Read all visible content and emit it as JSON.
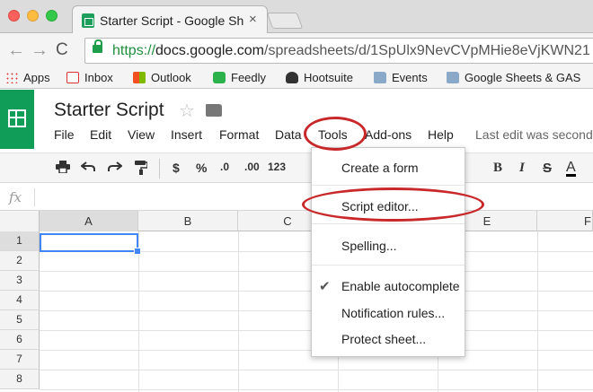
{
  "browser": {
    "tab_title": "Starter Script - Google Sheets",
    "tab_close": "×",
    "nav": {
      "back": "←",
      "forward": "→",
      "reload": "C"
    },
    "url_scheme": "https://",
    "url_host": "docs.google.com",
    "url_path": "/spreadsheets/d/1SpUlx9NevCVpMHie8eVjKWN21",
    "bookmarks": [
      {
        "label": "Apps",
        "icon": "apps-grid-icon"
      },
      {
        "label": "Inbox",
        "icon": "gmail-icon"
      },
      {
        "label": "Outlook",
        "icon": "outlook-icon"
      },
      {
        "label": "Feedly",
        "icon": "feedly-icon"
      },
      {
        "label": "Hootsuite",
        "icon": "hootsuite-icon"
      },
      {
        "label": "Events",
        "icon": "folder-icon"
      },
      {
        "label": "Google Sheets & GAS",
        "icon": "folder-icon"
      }
    ]
  },
  "doc": {
    "title": "Starter Script",
    "star": "☆",
    "last_edit": "Last edit was second"
  },
  "menus": [
    "File",
    "Edit",
    "View",
    "Insert",
    "Format",
    "Data",
    "Tools",
    "Add-ons",
    "Help"
  ],
  "toolbar": {
    "currency": "$",
    "percent": "%",
    "dec_decrease": ".0",
    "dec_increase": ".00",
    "more_formats": "123",
    "bold": "B",
    "italic": "I",
    "strike": "S",
    "text_color": "A"
  },
  "formula_bar": {
    "fx": "fx"
  },
  "grid": {
    "columns": [
      "A",
      "B",
      "C",
      "D",
      "E",
      "F"
    ],
    "rows": [
      "1",
      "2",
      "3",
      "4",
      "5",
      "6",
      "7",
      "8"
    ],
    "active_cell": "A1"
  },
  "tools_menu": {
    "items": [
      "Create a form",
      "Script editor...",
      "Spelling...",
      "Enable autocomplete",
      "Notification rules...",
      "Protect sheet..."
    ],
    "checked": "Enable autocomplete",
    "check_mark": "✔"
  },
  "colors": {
    "sheets_green": "#0f9d58",
    "highlight_red": "#c8282a",
    "selection_blue": "#4285f4"
  }
}
